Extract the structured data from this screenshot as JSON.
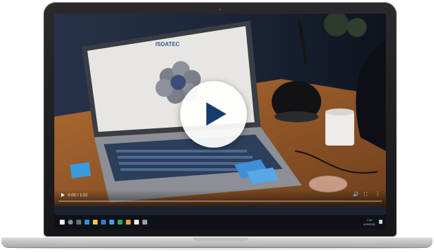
{
  "video": {
    "time_display": "0:00 / 1:02",
    "progress_fraction": 0.0,
    "brand_on_screen": "ISOATEC",
    "controls": {
      "play_icon": "play-icon",
      "volume_icon": "volume-icon",
      "fullscreen_icon": "fullscreen-icon",
      "menu_icon": "more-vertical-icon"
    }
  },
  "taskbar": {
    "clock_time": "7:30",
    "clock_date": "1/28/2021"
  },
  "colors": {
    "play_glyph": "#163c6e",
    "desk_wood": "#9a5e2e",
    "scene_bg": "#1b2230"
  }
}
